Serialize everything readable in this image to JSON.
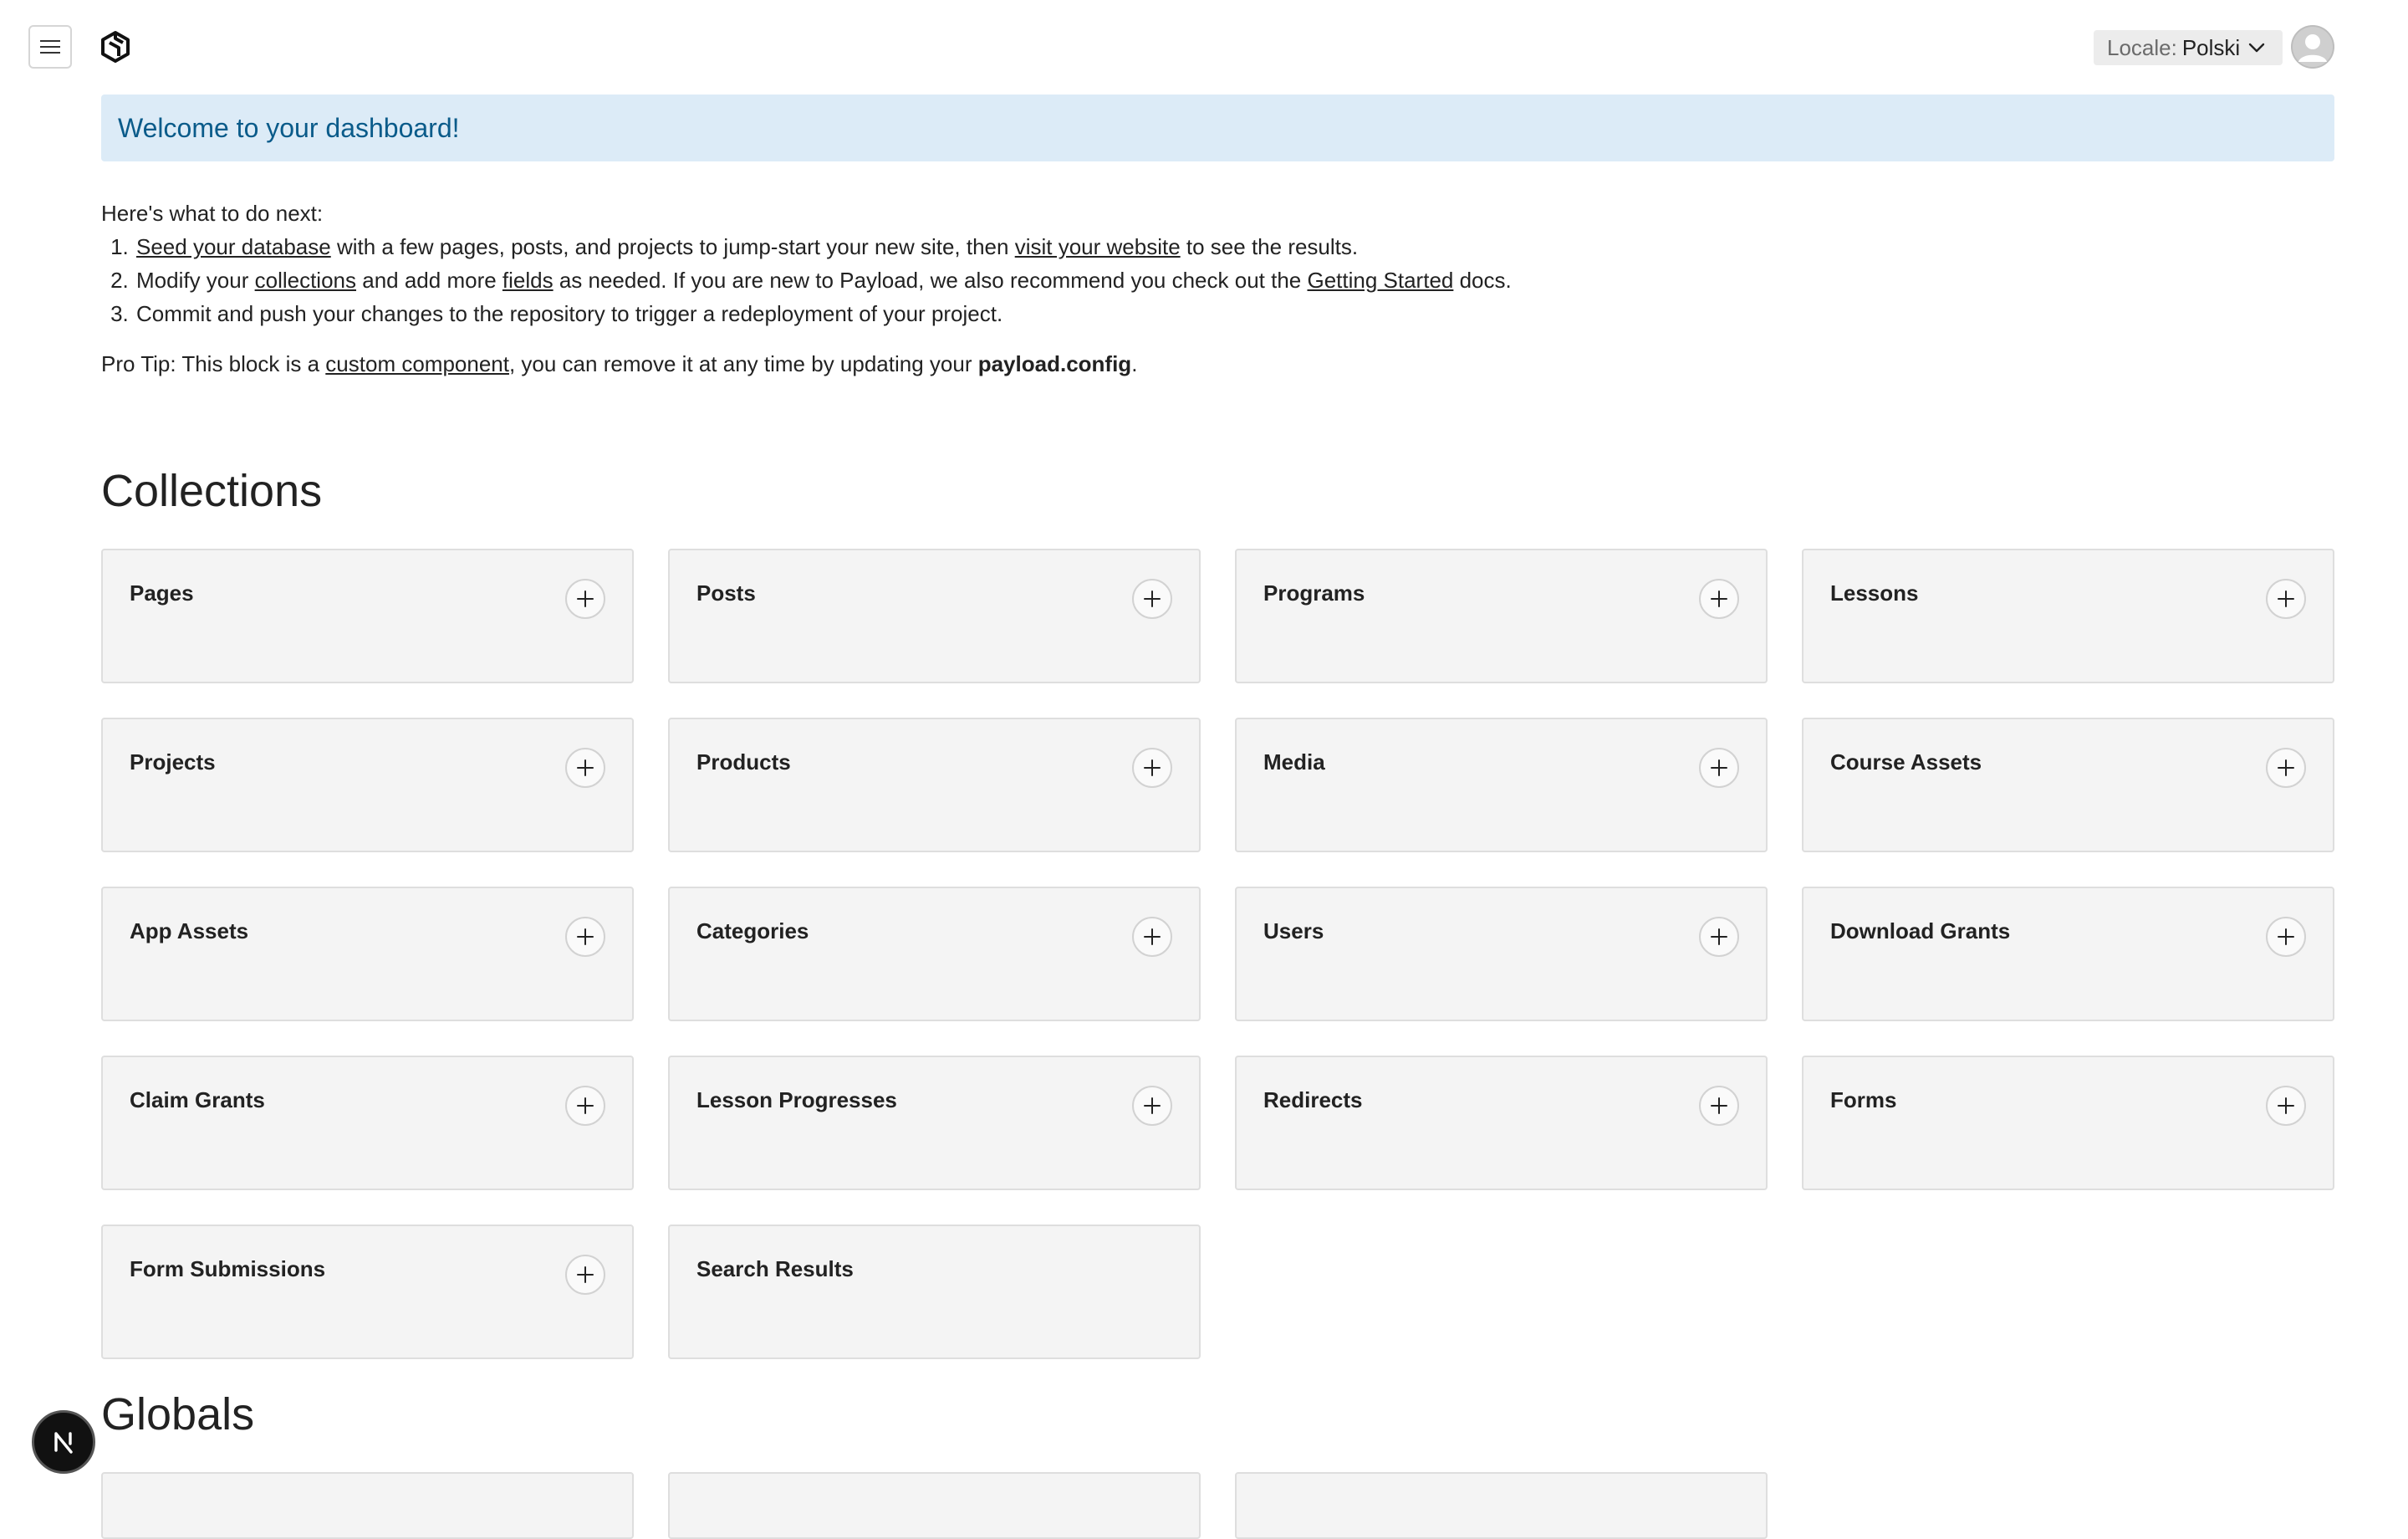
{
  "header": {
    "locale_label": "Locale:",
    "locale_value": "Polski"
  },
  "welcome": {
    "title": "Welcome to your dashboard!"
  },
  "instructions": {
    "intro": "Here's what to do next:",
    "step1": {
      "link1": "Seed your database",
      "text1": " with a few pages, posts, and projects to jump-start your new site, then ",
      "link2": "visit your website",
      "text2": " to see the results."
    },
    "step2": {
      "text1": "Modify your ",
      "link1": "collections",
      "text2": " and add more ",
      "link2": "fields",
      "text3": " as needed. If you are new to Payload, we also recommend you check out the ",
      "link3": "Getting Started",
      "text4": " docs."
    },
    "step3": {
      "text1": "Commit and push your changes to the repository to trigger a redeployment of your project."
    },
    "protip": {
      "text1": "Pro Tip: This block is a ",
      "link1": "custom component",
      "text2": ", you can remove it at any time by updating your ",
      "bold1": "payload.config",
      "text3": "."
    }
  },
  "collections": {
    "title": "Collections",
    "items": [
      {
        "label": "Pages"
      },
      {
        "label": "Posts"
      },
      {
        "label": "Programs"
      },
      {
        "label": "Lessons"
      },
      {
        "label": "Projects"
      },
      {
        "label": "Products"
      },
      {
        "label": "Media"
      },
      {
        "label": "Course Assets"
      },
      {
        "label": "App Assets"
      },
      {
        "label": "Categories"
      },
      {
        "label": "Users"
      },
      {
        "label": "Download Grants"
      },
      {
        "label": "Claim Grants"
      },
      {
        "label": "Lesson Progresses"
      },
      {
        "label": "Redirects"
      },
      {
        "label": "Forms"
      },
      {
        "label": "Form Submissions"
      },
      {
        "label": "Search Results"
      }
    ]
  },
  "globals": {
    "title": "Globals"
  },
  "badge": {
    "letter": "N"
  }
}
